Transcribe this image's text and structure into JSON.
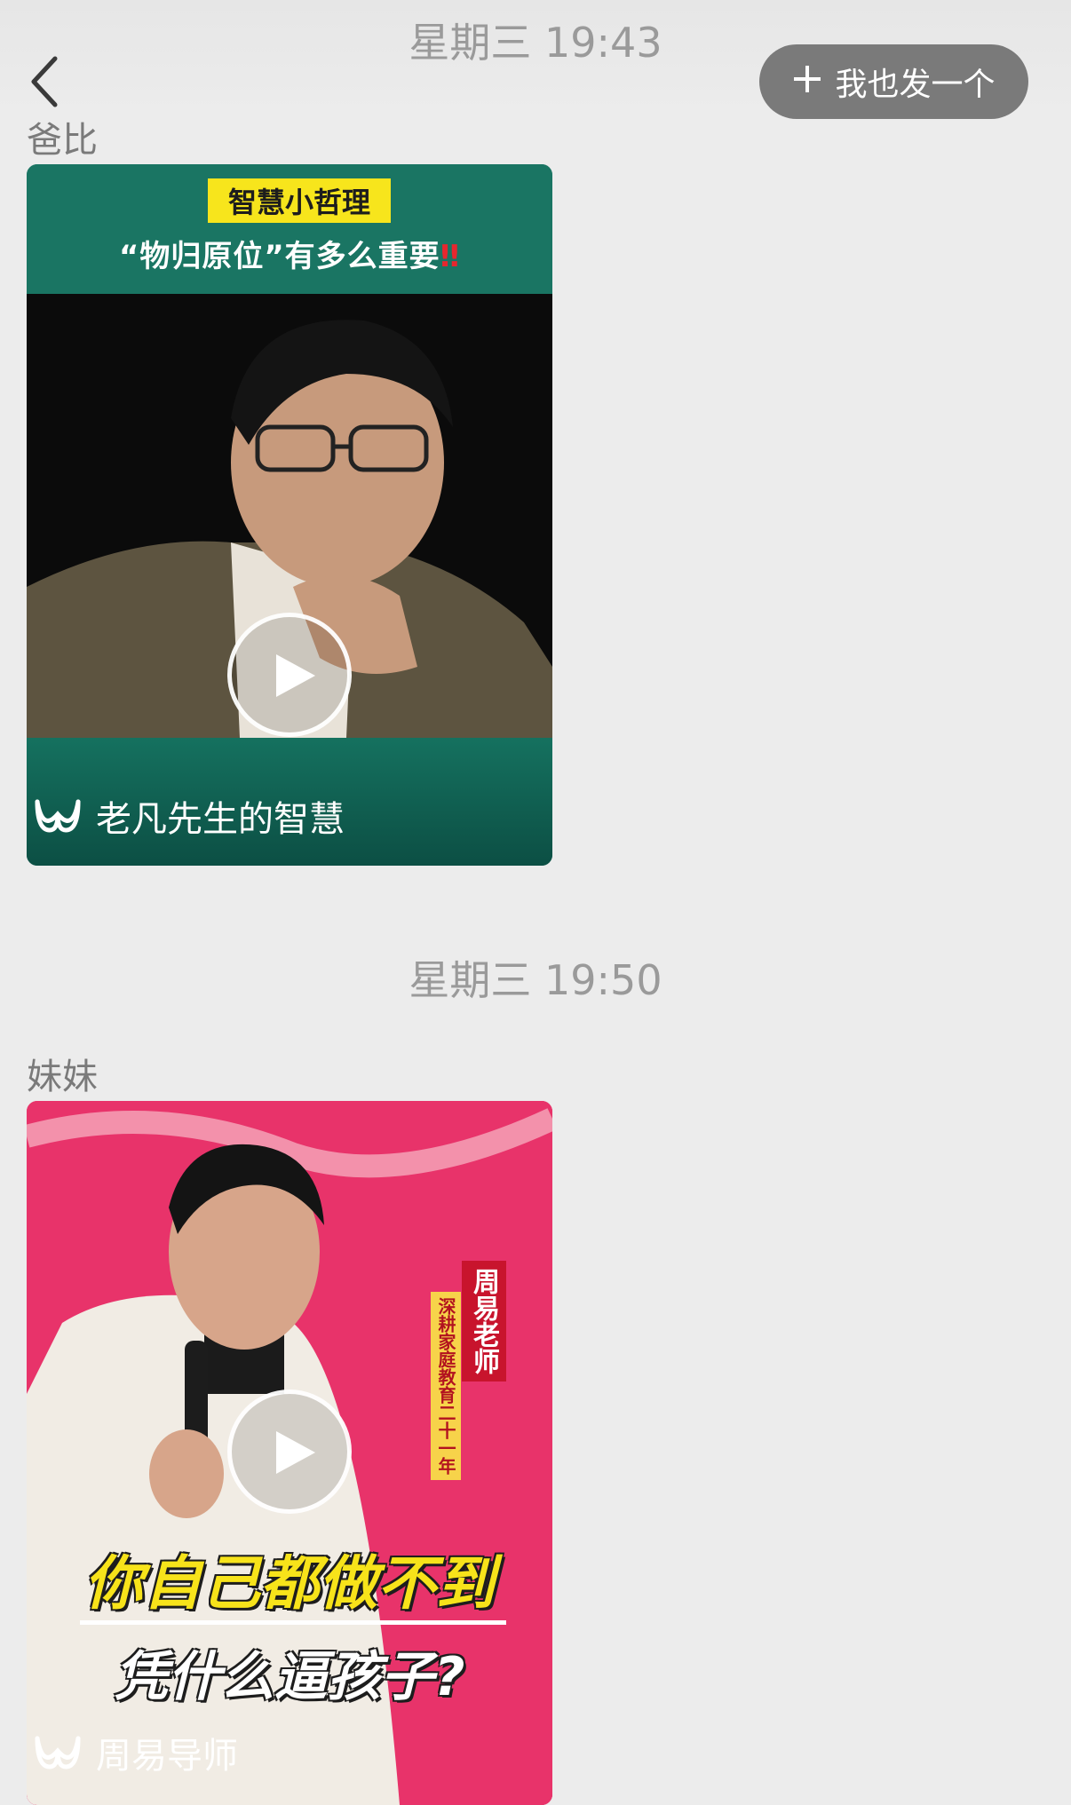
{
  "header": {
    "back_label": "back",
    "post_button_label": "我也发一个",
    "post_button_icon": "plus-icon"
  },
  "messages": [
    {
      "time": "星期三 19:43",
      "sender": "爸比",
      "video": {
        "tag": "智慧小哲理",
        "subtitle": "“物归原位”有多么重要",
        "subtitle_mark": "‼",
        "channel": "老凡先生的智慧",
        "channel_icon": "channels-logo-icon",
        "theme_color": "#156e60"
      }
    },
    {
      "time": "星期三 19:50",
      "sender": "妹妹",
      "video": {
        "name_tag": "周易老师",
        "name_sub": "深耕家庭教育二十一年",
        "caption_line1": "你自己都做不到",
        "caption_line2": "凭什么逼孩子?",
        "channel": "周易导师",
        "channel_icon": "channels-logo-icon",
        "theme_color": "#e9316a"
      }
    }
  ]
}
